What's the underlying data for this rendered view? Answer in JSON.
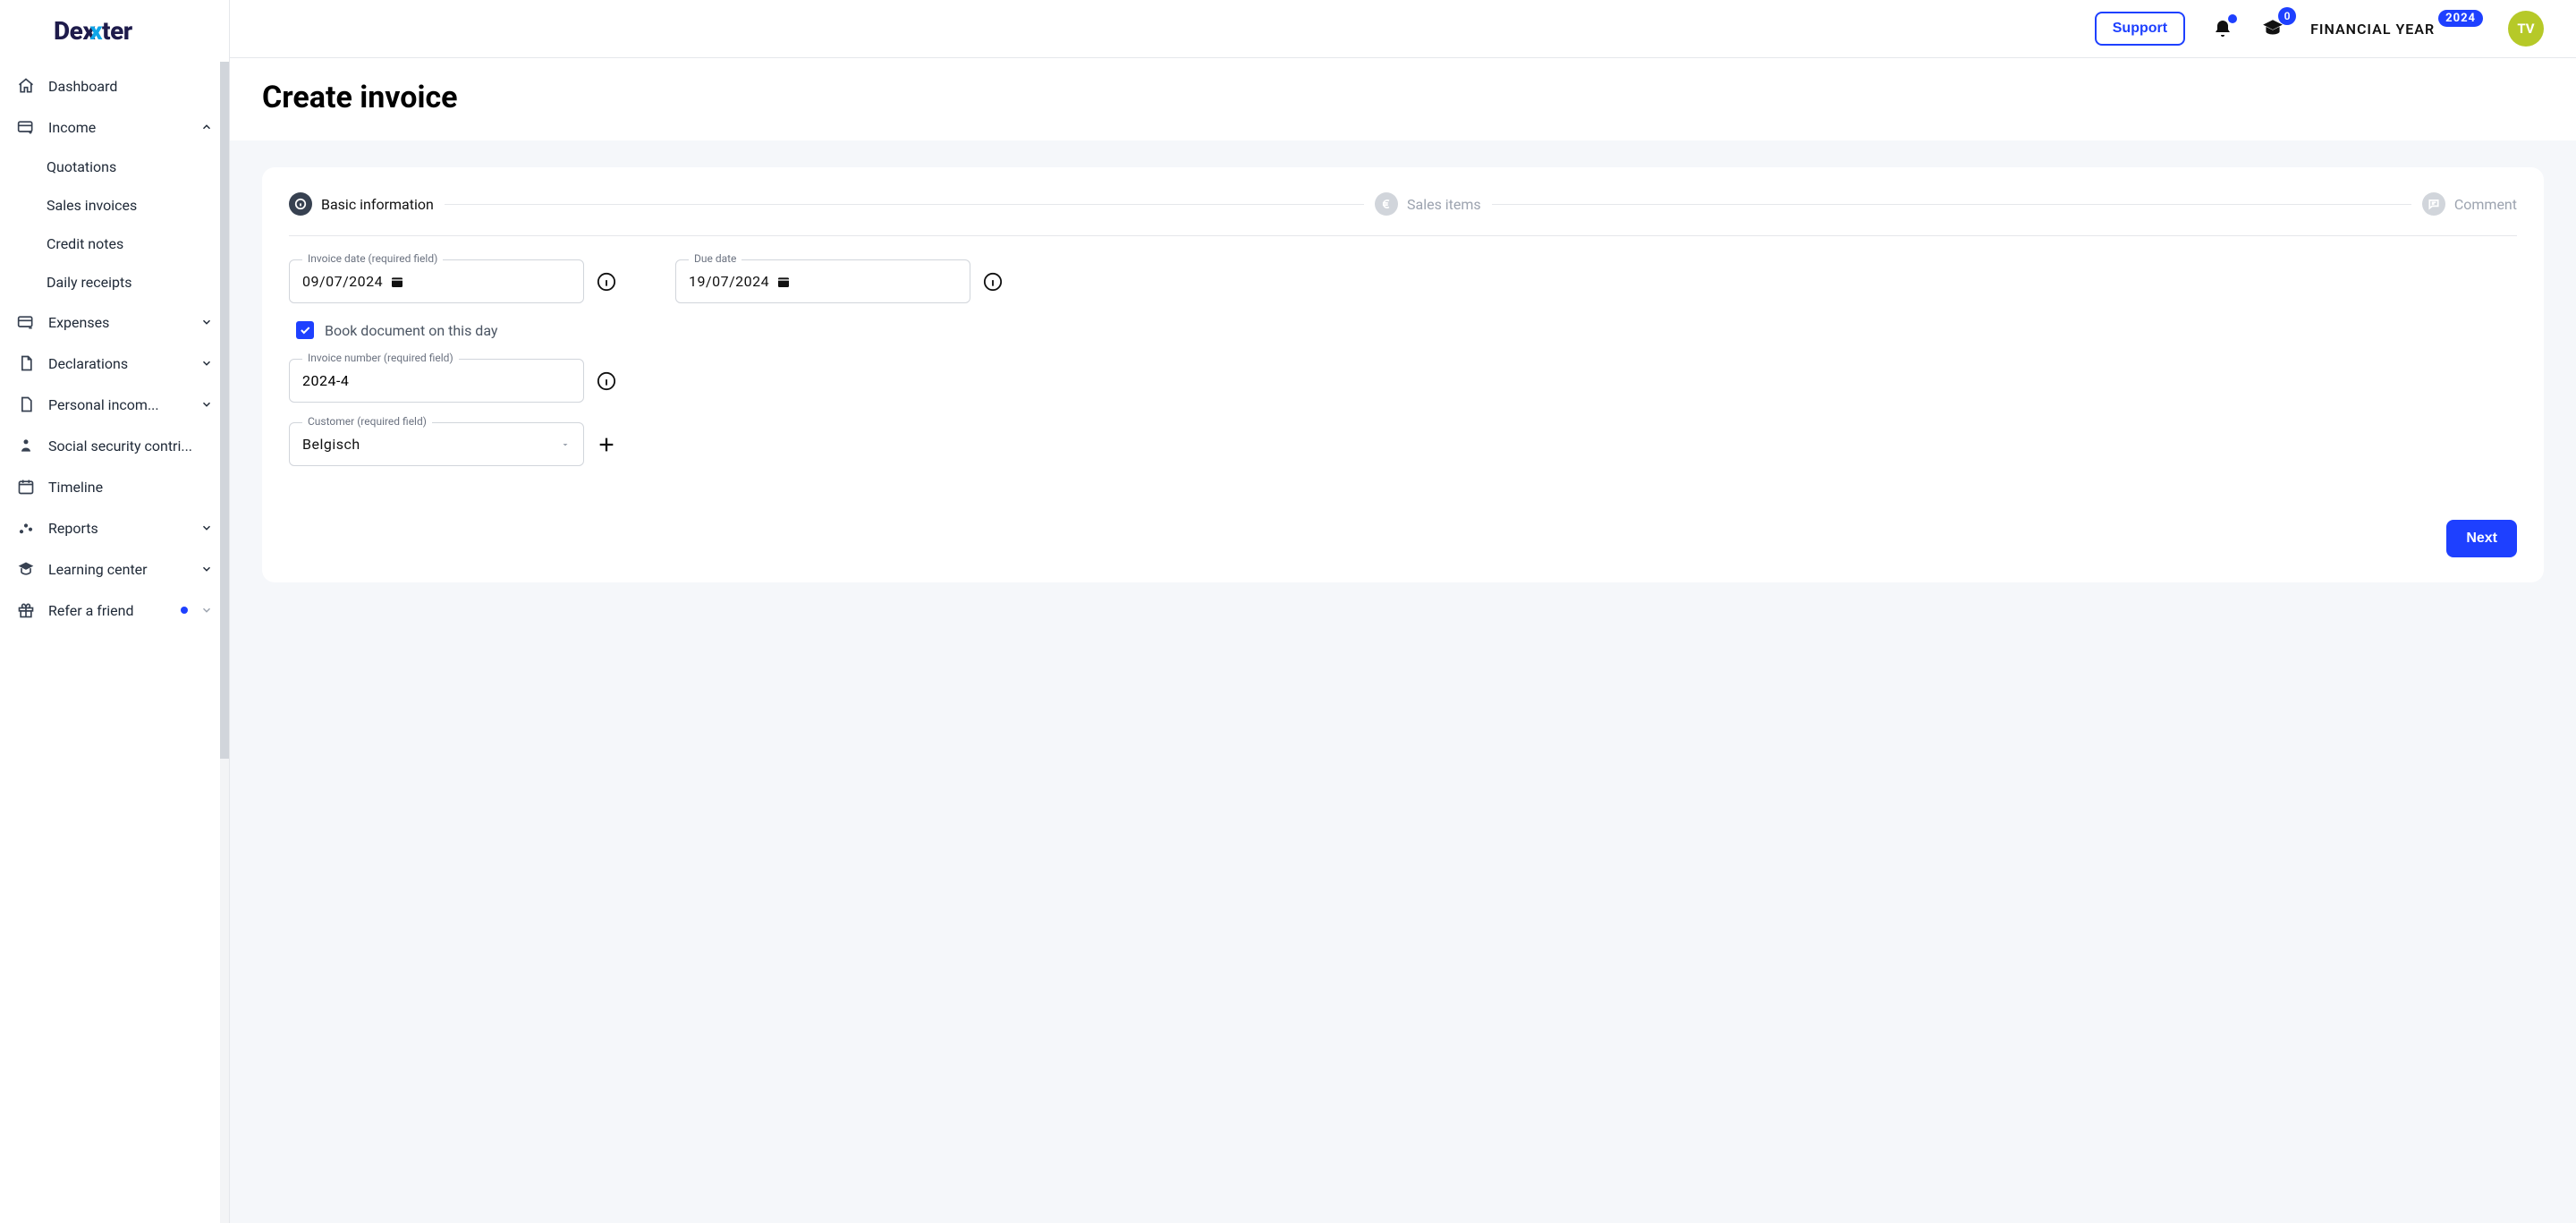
{
  "brand": {
    "name": "Dexter"
  },
  "topbar": {
    "support_label": "Support",
    "notifications_count_dot": true,
    "learning_count": "0",
    "financial_year_label": "FINANCIAL YEAR",
    "financial_year_value": "2024",
    "avatar_initials": "TV"
  },
  "sidebar": {
    "items": [
      {
        "label": "Dashboard"
      },
      {
        "label": "Income",
        "expanded": true,
        "children": [
          {
            "label": "Quotations"
          },
          {
            "label": "Sales invoices"
          },
          {
            "label": "Credit notes"
          },
          {
            "label": "Daily receipts"
          }
        ]
      },
      {
        "label": "Expenses"
      },
      {
        "label": "Declarations"
      },
      {
        "label": "Personal incom..."
      },
      {
        "label": "Social security contri..."
      },
      {
        "label": "Timeline"
      },
      {
        "label": "Reports"
      },
      {
        "label": "Learning center"
      },
      {
        "label": "Refer a friend",
        "has_dot": true
      }
    ]
  },
  "page": {
    "title": "Create invoice"
  },
  "stepper": {
    "steps": [
      {
        "label": "Basic information",
        "active": true
      },
      {
        "label": "Sales items",
        "active": false
      },
      {
        "label": "Comment",
        "active": false
      }
    ]
  },
  "form": {
    "invoice_date": {
      "label": "Invoice date (required field)",
      "value": "09/07/2024"
    },
    "due_date": {
      "label": "Due date",
      "value": "19/07/2024"
    },
    "book_checkbox": {
      "checked": true,
      "label": "Book document on this day"
    },
    "invoice_number": {
      "label": "Invoice number (required field)",
      "value": "2024-4"
    },
    "customer": {
      "label": "Customer (required field)",
      "value": "Belgisch"
    },
    "next_label": "Next"
  }
}
